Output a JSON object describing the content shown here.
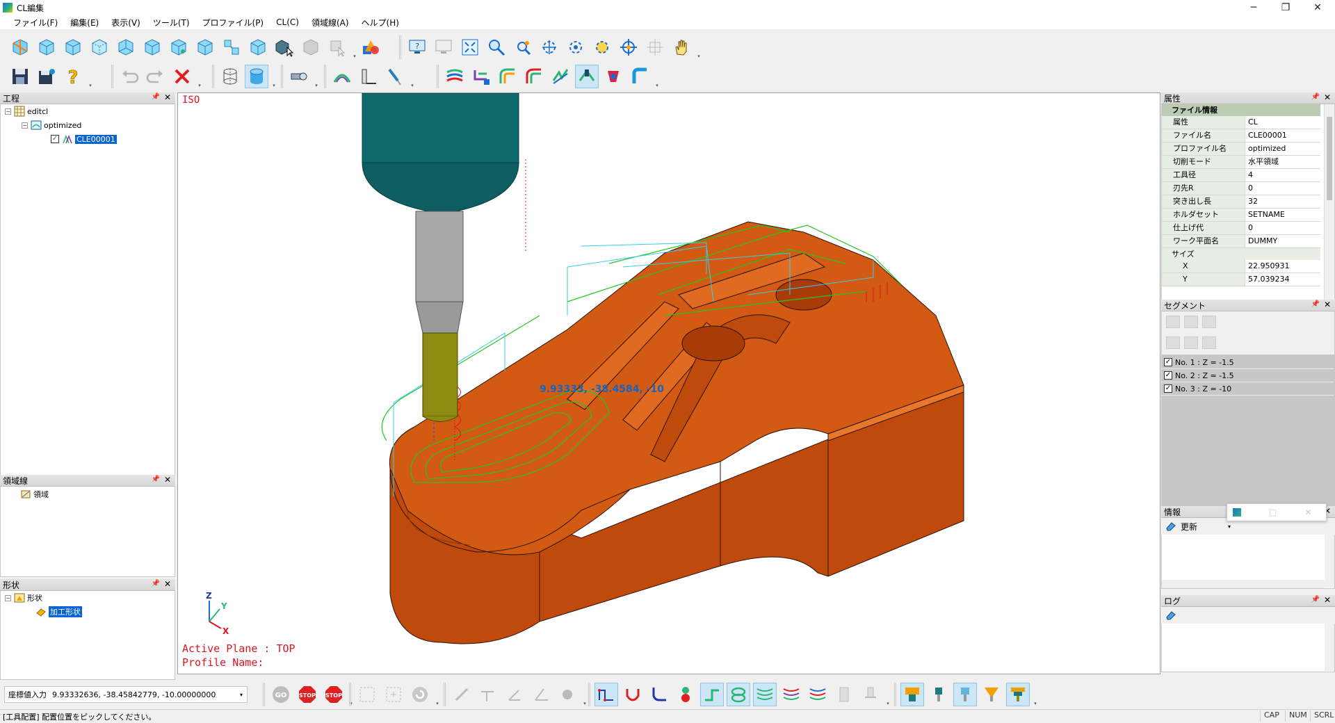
{
  "window": {
    "title": "CL編集"
  },
  "menu": [
    "ファイル(F)",
    "編集(E)",
    "表示(V)",
    "ツール(T)",
    "プロファイル(P)",
    "CL(C)",
    "領域線(A)",
    "ヘルプ(H)"
  ],
  "panels": {
    "process": {
      "title": "工程",
      "tree": {
        "root": "editcl",
        "child": "optimized",
        "leaf": "CLE00001"
      }
    },
    "region": {
      "title": "領域線",
      "item": "領域"
    },
    "shape": {
      "title": "形状",
      "root": "形状",
      "child": "加工形状"
    },
    "properties": {
      "title": "属性",
      "category_file": "ファイル情報",
      "rows": [
        {
          "key": "属性",
          "value": "CL"
        },
        {
          "key": "ファイル名",
          "value": "CLE00001"
        },
        {
          "key": "プロファイル名",
          "value": "optimized"
        },
        {
          "key": "切削モード",
          "value": "水平領域"
        },
        {
          "key": "工具径",
          "value": "4"
        },
        {
          "key": "刃先R",
          "value": "0"
        },
        {
          "key": "突き出し長",
          "value": "32"
        },
        {
          "key": "ホルダセット",
          "value": "SETNAME"
        },
        {
          "key": "仕上げ代",
          "value": "0"
        },
        {
          "key": "ワーク平面名",
          "value": "DUMMY"
        }
      ],
      "category_size": "サイズ",
      "size_rows": [
        {
          "key": "X",
          "value": "22.950931"
        },
        {
          "key": "Y",
          "value": "57.039234"
        }
      ]
    },
    "segment": {
      "title": "セグメント",
      "rows": [
        "No. 1 : Z = -1.5",
        "No. 2 : Z = -1.5",
        "No. 3 : Z = -10"
      ]
    },
    "info": {
      "title": "情報",
      "update_label": "更新"
    },
    "log": {
      "title": "ログ"
    }
  },
  "viewport": {
    "view_name": "ISO",
    "active_plane": "Active Plane : TOP",
    "profile_name": "Profile Name:",
    "coord_label": "9.93333, -38.4584, -10",
    "axis": {
      "z": "Z",
      "y": "Y",
      "x": "X"
    }
  },
  "coordinate_input": {
    "label": "座標値入力",
    "value": "9.93332636, -38.45842779, -10.00000000"
  },
  "status": {
    "message": "[工具配置] 配置位置をピックしてください。",
    "indicators": [
      "CAP",
      "NUM",
      "SCRL"
    ]
  },
  "buttons": {
    "go": "GO",
    "stop": "STOP"
  },
  "colors": {
    "workpiece": "#c8520f",
    "spindle": "#0f6a6e",
    "selection": "#0a64d2",
    "toolpath": "#2ecc2e"
  }
}
